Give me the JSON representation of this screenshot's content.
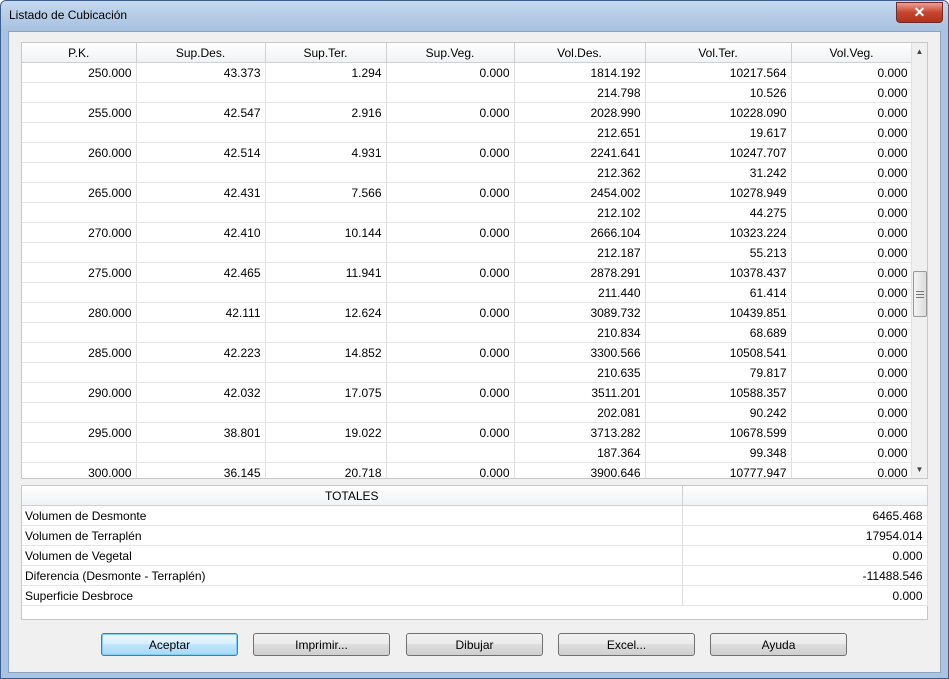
{
  "window": {
    "title": "Listado de Cubicación",
    "close_glyph": "✕"
  },
  "columns": [
    "P.K.",
    "Sup.Des.",
    "Sup.Ter.",
    "Sup.Veg.",
    "Vol.Des.",
    "Vol.Ter.",
    "Vol.Veg."
  ],
  "rows": [
    [
      "250.000",
      "43.373",
      "1.294",
      "0.000",
      "1814.192",
      "10217.564",
      "0.000"
    ],
    [
      "",
      "",
      "",
      "",
      "214.798",
      "10.526",
      "0.000"
    ],
    [
      "255.000",
      "42.547",
      "2.916",
      "0.000",
      "2028.990",
      "10228.090",
      "0.000"
    ],
    [
      "",
      "",
      "",
      "",
      "212.651",
      "19.617",
      "0.000"
    ],
    [
      "260.000",
      "42.514",
      "4.931",
      "0.000",
      "2241.641",
      "10247.707",
      "0.000"
    ],
    [
      "",
      "",
      "",
      "",
      "212.362",
      "31.242",
      "0.000"
    ],
    [
      "265.000",
      "42.431",
      "7.566",
      "0.000",
      "2454.002",
      "10278.949",
      "0.000"
    ],
    [
      "",
      "",
      "",
      "",
      "212.102",
      "44.275",
      "0.000"
    ],
    [
      "270.000",
      "42.410",
      "10.144",
      "0.000",
      "2666.104",
      "10323.224",
      "0.000"
    ],
    [
      "",
      "",
      "",
      "",
      "212.187",
      "55.213",
      "0.000"
    ],
    [
      "275.000",
      "42.465",
      "11.941",
      "0.000",
      "2878.291",
      "10378.437",
      "0.000"
    ],
    [
      "",
      "",
      "",
      "",
      "211.440",
      "61.414",
      "0.000"
    ],
    [
      "280.000",
      "42.111",
      "12.624",
      "0.000",
      "3089.732",
      "10439.851",
      "0.000"
    ],
    [
      "",
      "",
      "",
      "",
      "210.834",
      "68.689",
      "0.000"
    ],
    [
      "285.000",
      "42.223",
      "14.852",
      "0.000",
      "3300.566",
      "10508.541",
      "0.000"
    ],
    [
      "",
      "",
      "",
      "",
      "210.635",
      "79.817",
      "0.000"
    ],
    [
      "290.000",
      "42.032",
      "17.075",
      "0.000",
      "3511.201",
      "10588.357",
      "0.000"
    ],
    [
      "",
      "",
      "",
      "",
      "202.081",
      "90.242",
      "0.000"
    ],
    [
      "295.000",
      "38.801",
      "19.022",
      "0.000",
      "3713.282",
      "10678.599",
      "0.000"
    ],
    [
      "",
      "",
      "",
      "",
      "187.364",
      "99.348",
      "0.000"
    ],
    [
      "300.000",
      "36.145",
      "20.718",
      "0.000",
      "3900.646",
      "10777.947",
      "0.000"
    ]
  ],
  "scrollbar": {
    "up_glyph": "▲",
    "down_glyph": "▼",
    "position": 0.55
  },
  "totals": {
    "header": "TOTALES",
    "rows": [
      {
        "label": "Volumen de Desmonte",
        "value": "6465.468"
      },
      {
        "label": "Volumen de Terraplén",
        "value": "17954.014"
      },
      {
        "label": "Volumen de Vegetal",
        "value": "0.000"
      },
      {
        "label": "Diferencia (Desmonte - Terraplén)",
        "value": "-11488.546"
      },
      {
        "label": "Superficie Desbroce",
        "value": "0.000"
      }
    ]
  },
  "buttons": {
    "aceptar": "Aceptar",
    "imprimir": "Imprimir...",
    "dibujar": "Dibujar",
    "excel": "Excel...",
    "ayuda": "Ayuda"
  }
}
